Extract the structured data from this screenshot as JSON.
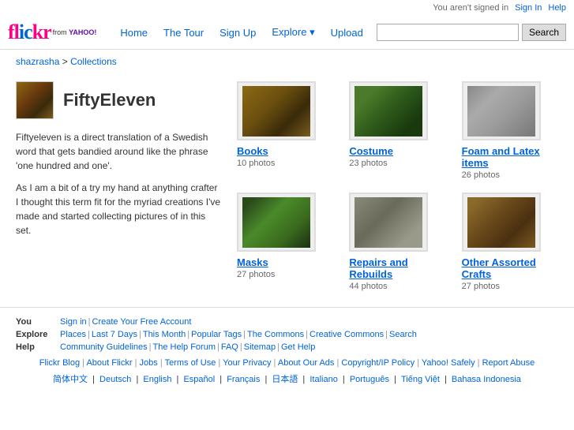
{
  "topbar": {
    "signed_out_text": "You aren't signed in",
    "sign_in_label": "Sign In",
    "help_label": "Help"
  },
  "logo": {
    "text": "flickr",
    "from_text": "from",
    "yahoo_text": "YAHOO!"
  },
  "nav": {
    "home": "Home",
    "tour": "The Tour",
    "signup": "Sign Up",
    "explore": "Explore",
    "upload": "Upload"
  },
  "search": {
    "placeholder": "",
    "button_label": "Search"
  },
  "breadcrumb": {
    "user": "shazrasha",
    "page": "Collections"
  },
  "profile": {
    "username": "FiftyEleven",
    "description_1": "Fiftyeleven is a direct translation of a Swedish word that gets bandied around like the phrase 'one hundred and one'.",
    "description_2": "As I am a bit of a try my hand at anything crafter I thought this term fit for the myriad creations I've made and started collecting pictures of in this set."
  },
  "collections": [
    {
      "id": "books",
      "title": "Books",
      "count": "10 photos",
      "thumb_class": "thumb-books"
    },
    {
      "id": "costume",
      "title": "Costume",
      "count": "23 photos",
      "thumb_class": "thumb-costume"
    },
    {
      "id": "foam",
      "title": "Foam and Latex items",
      "count": "26 photos",
      "thumb_class": "thumb-foam"
    },
    {
      "id": "masks",
      "title": "Masks",
      "count": "27 photos",
      "thumb_class": "thumb-masks"
    },
    {
      "id": "repairs",
      "title": "Repairs and Rebuilds",
      "count": "44 photos",
      "thumb_class": "thumb-repairs"
    },
    {
      "id": "other",
      "title": "Other Assorted Crafts",
      "count": "27 photos",
      "thumb_class": "thumb-other"
    }
  ],
  "footer": {
    "you_label": "You",
    "explore_label": "Explore",
    "help_label": "Help",
    "you_links": [
      "Sign in",
      "Create Your Free Account"
    ],
    "explore_links": [
      "Places",
      "Last 7 Days",
      "This Month",
      "Popular Tags",
      "The Commons",
      "Creative Commons",
      "Search"
    ],
    "help_links": [
      "Community Guidelines",
      "The Help Forum",
      "FAQ",
      "Sitemap",
      "Get Help"
    ],
    "bottom_links": [
      "Flickr Blog",
      "About Flickr",
      "Jobs",
      "Terms of Use",
      "Your Privacy",
      "About Our Ads",
      "Copyright/IP Policy",
      "Yahoo! Safely",
      "Report Abuse"
    ],
    "lang_links": [
      "简体中文",
      "Deutsch",
      "English",
      "Español",
      "Français",
      "日本語",
      "Italiano",
      "Português",
      "Tiếng Việt",
      "Bahasa Indonesia"
    ]
  }
}
